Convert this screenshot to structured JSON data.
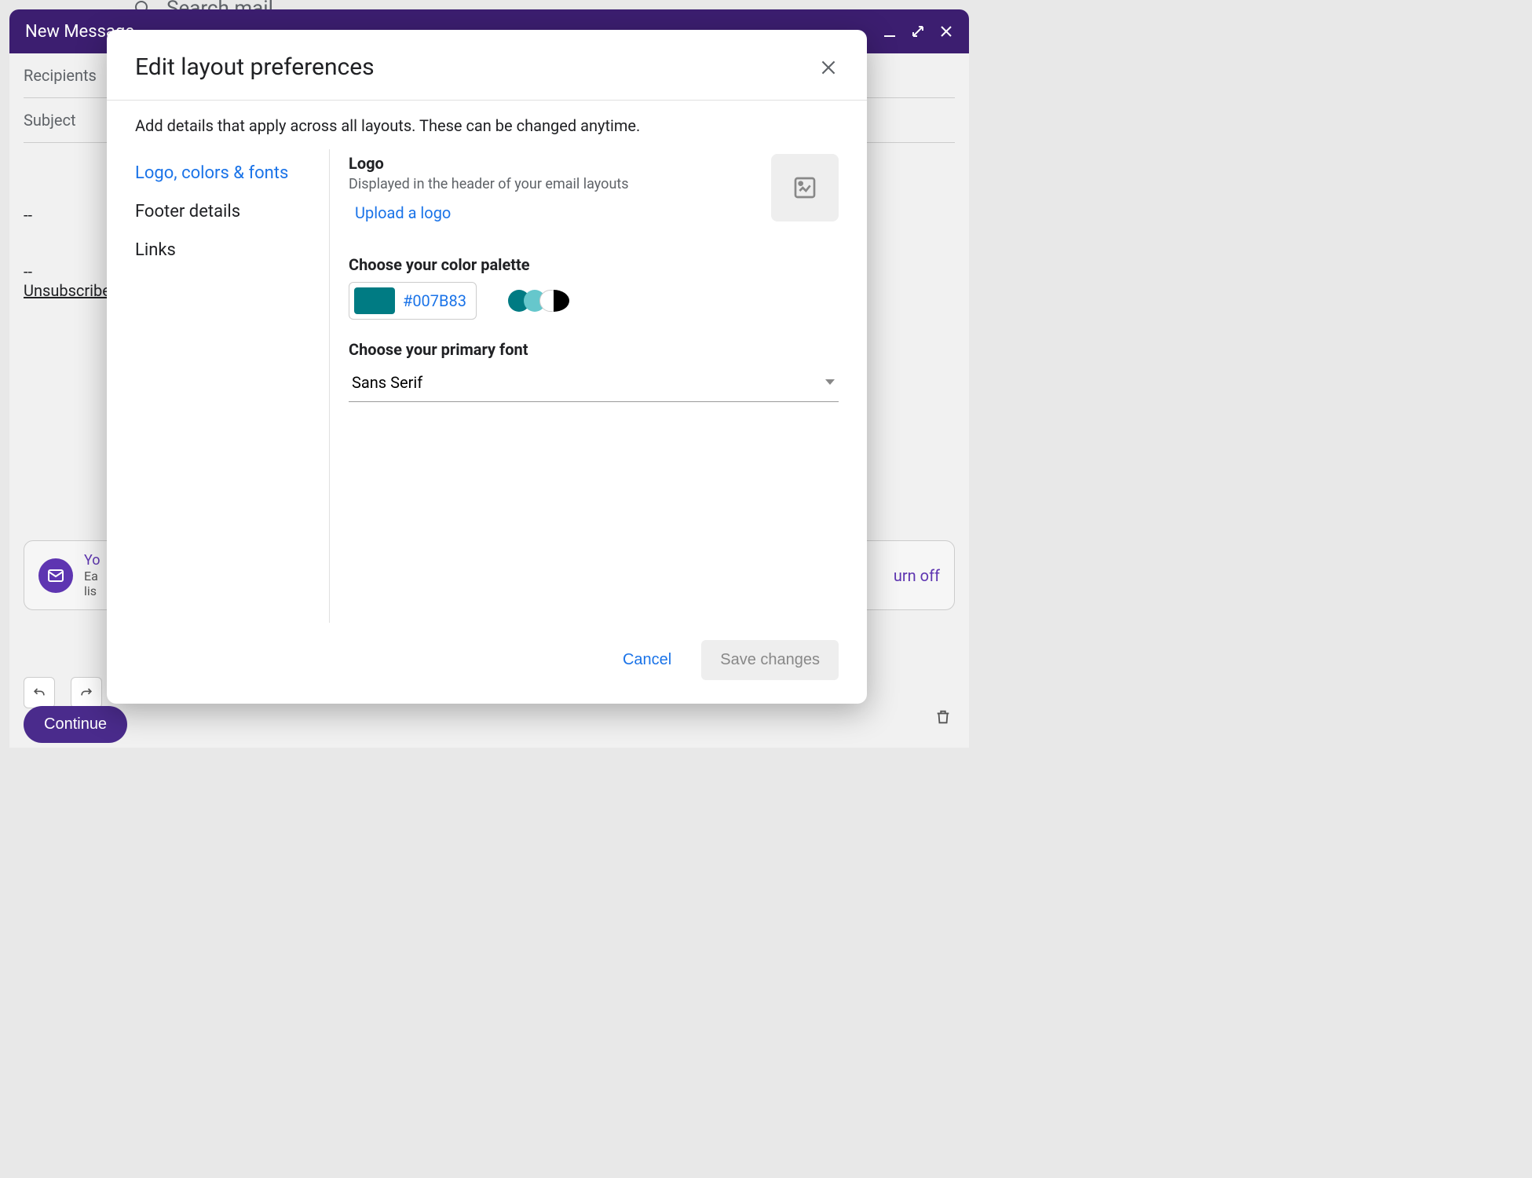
{
  "background": {
    "search_placeholder": "Search mail"
  },
  "compose": {
    "title": "New Message",
    "recipients_label": "Recipients",
    "subject_label": "Subject",
    "body_dashes": "--",
    "unsubscribe_text": "Unsubscribe",
    "continue_label": "Continue",
    "banner": {
      "partial_link": "Yo",
      "line2_partial": "Ea",
      "line3_partial": "lis",
      "turnoff": "urn off"
    }
  },
  "modal": {
    "title": "Edit layout preferences",
    "subtitle": "Add details that apply across all layouts. These can be changed anytime.",
    "nav": {
      "logo_colors_fonts": "Logo, colors & fonts",
      "footer_details": "Footer details",
      "links": "Links"
    },
    "logo": {
      "heading": "Logo",
      "description": "Displayed in the header of your email layouts",
      "upload_label": "Upload a logo"
    },
    "palette": {
      "heading": "Choose your color palette",
      "hex": "#007B83",
      "swatch_color": "#007B83"
    },
    "font": {
      "heading": "Choose your primary font",
      "selected": "Sans Serif"
    },
    "footer": {
      "cancel": "Cancel",
      "save": "Save changes"
    }
  }
}
